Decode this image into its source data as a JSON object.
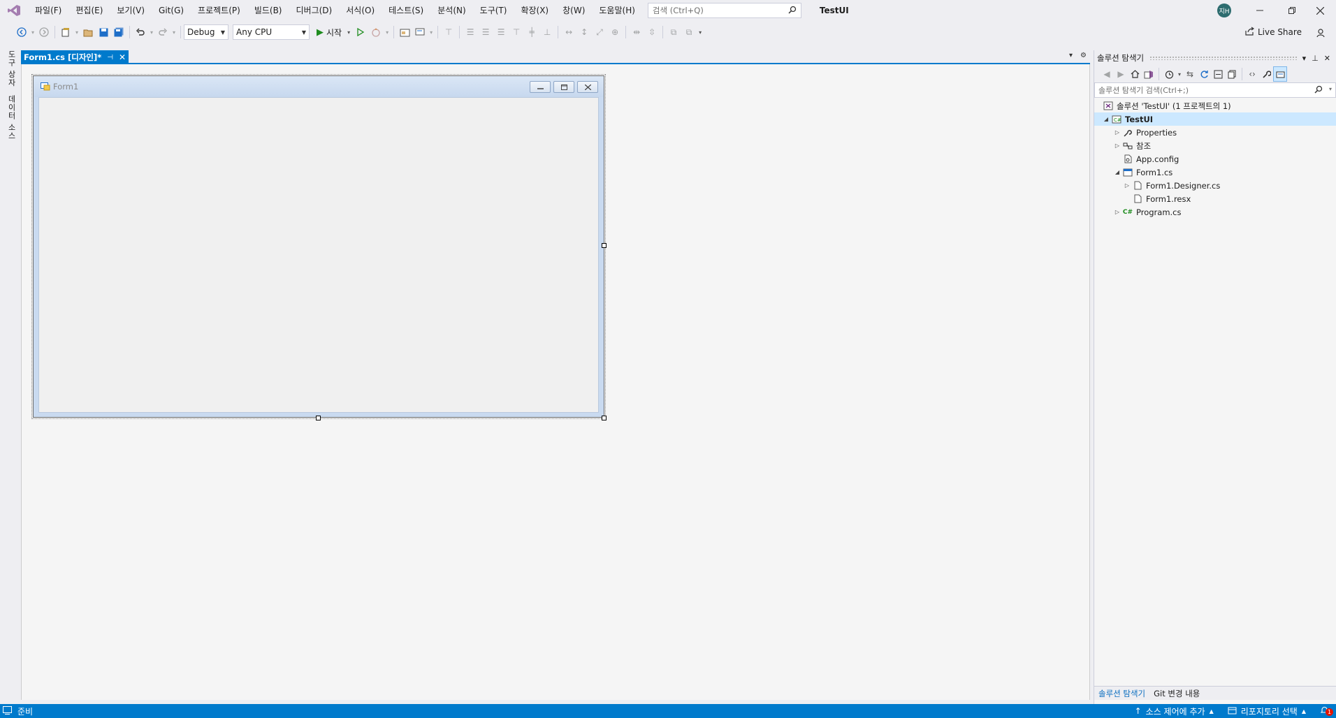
{
  "menubar": {
    "items": [
      "파일(F)",
      "편집(E)",
      "보기(V)",
      "Git(G)",
      "프로젝트(P)",
      "빌드(B)",
      "디버그(D)",
      "서식(O)",
      "테스트(S)",
      "분석(N)",
      "도구(T)",
      "확장(X)",
      "창(W)",
      "도움말(H)"
    ],
    "search_placeholder": "검색 (Ctrl+Q)",
    "app_title": "TestUI",
    "avatar_initials": "지H"
  },
  "toolbar": {
    "config": "Debug",
    "platform": "Any CPU",
    "start_label": "시작",
    "live_share": "Live Share"
  },
  "left_tabs": {
    "toolbox": "도구 상자",
    "data_sources": "데이터 소스"
  },
  "document": {
    "tab_label": "Form1.cs [디자인]*",
    "form_title": "Form1"
  },
  "solution_explorer": {
    "title": "솔루션 탐색기",
    "search_placeholder": "솔루션 탐색기 검색(Ctrl+;)",
    "tree": {
      "solution": "솔루션 'TestUI' (1 프로젝트의 1)",
      "project": "TestUI",
      "properties": "Properties",
      "references": "참조",
      "app_config": "App.config",
      "form1": "Form1.cs",
      "form1_designer": "Form1.Designer.cs",
      "form1_resx": "Form1.resx",
      "program": "Program.cs"
    },
    "bottom_tabs": [
      "솔루션 탐색기",
      "Git 변경 내용"
    ]
  },
  "statusbar": {
    "ready": "준비",
    "add_source_control": "소스 제어에 추가",
    "select_repository": "리포지토리 선택",
    "notification_count": "1"
  },
  "colors": {
    "accent": "#007acc",
    "chrome": "#eeeef2",
    "designer_bg": "#f5f5f5"
  }
}
